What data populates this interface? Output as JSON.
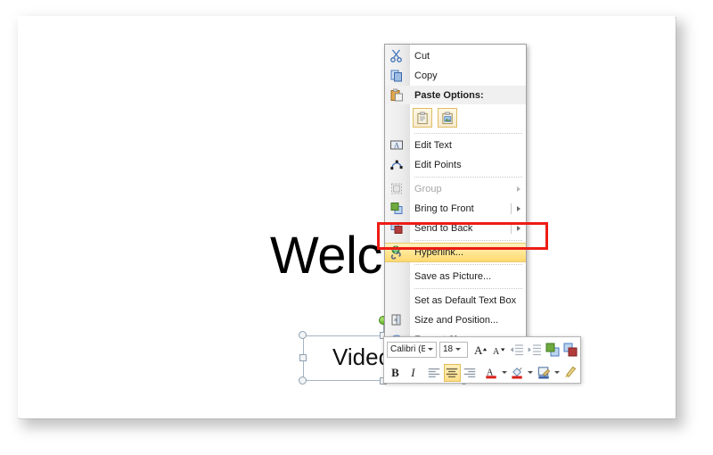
{
  "slide": {
    "title": "Welcome",
    "textbox": {
      "text": "Video 1",
      "name": "video-1-textbox"
    }
  },
  "context_menu": {
    "items": [
      {
        "id": "cut",
        "label": "Cut",
        "accel": "t",
        "icon": "scissors-icon",
        "state": "normal",
        "submenu": false
      },
      {
        "id": "copy",
        "label": "Copy",
        "accel": "C",
        "icon": "copy-pages-icon",
        "state": "normal",
        "submenu": false
      },
      {
        "id": "paste-options",
        "label": "Paste Options:",
        "accel": "",
        "icon": "clipboard-paste-icon",
        "state": "header",
        "submenu": false
      },
      {
        "id": "edit-text",
        "label": "Edit Text",
        "accel": "x",
        "icon": "edit-text-icon",
        "state": "normal",
        "submenu": false
      },
      {
        "id": "edit-points",
        "label": "Edit Points",
        "accel": "E",
        "icon": "edit-points-icon",
        "state": "normal",
        "submenu": false
      },
      {
        "id": "group",
        "label": "Group",
        "accel": "G",
        "icon": "group-icon",
        "state": "disabled",
        "submenu": true
      },
      {
        "id": "bring-to-front",
        "label": "Bring to Front",
        "accel": "r",
        "icon": "bring-front-icon",
        "state": "normal",
        "submenu": true
      },
      {
        "id": "send-to-back",
        "label": "Send to Back",
        "accel": "k",
        "icon": "send-back-icon",
        "state": "normal",
        "submenu": true
      },
      {
        "id": "hyperlink",
        "label": "Hyperlink...",
        "accel": "H",
        "icon": "hyperlink-globe-icon",
        "state": "highlighted",
        "submenu": false
      },
      {
        "id": "save-as-picture",
        "label": "Save as Picture...",
        "accel": "S",
        "icon": "none",
        "state": "normal",
        "submenu": false
      },
      {
        "id": "set-default-textbox",
        "label": "Set as Default Text Box",
        "accel": "D",
        "icon": "none",
        "state": "normal",
        "submenu": false
      },
      {
        "id": "size-position",
        "label": "Size and Position...",
        "accel": "z",
        "icon": "size-position-icon",
        "state": "normal",
        "submenu": false
      },
      {
        "id": "format-shape",
        "label": "Format Shape...",
        "accel": "o",
        "icon": "format-shape-icon",
        "state": "normal",
        "submenu": false
      }
    ],
    "paste_buttons": [
      {
        "id": "paste-keep-source",
        "name": "paste-keep-source-formatting-button"
      },
      {
        "id": "paste-picture",
        "name": "paste-as-picture-button"
      }
    ]
  },
  "annotation": {
    "highlight_color": "#ee1c15",
    "target": "hyperlink"
  },
  "mini_toolbar": {
    "font_name": "Calibri (B",
    "font_size": "18",
    "buttons_row1": [
      {
        "id": "grow-font",
        "label": "A",
        "name": "grow-font-button"
      },
      {
        "id": "shrink-font",
        "label": "A",
        "name": "shrink-font-button"
      },
      {
        "id": "decrease-indent",
        "label": "",
        "name": "decrease-indent-button"
      },
      {
        "id": "increase-indent",
        "label": "",
        "name": "increase-indent-button"
      },
      {
        "id": "bring-forward",
        "label": "",
        "name": "bring-forward-button"
      },
      {
        "id": "send-backward",
        "label": "",
        "name": "send-backward-button"
      }
    ],
    "buttons_row2": [
      {
        "id": "bold",
        "label": "B",
        "name": "bold-button",
        "active": false
      },
      {
        "id": "italic",
        "label": "I",
        "name": "italic-button",
        "active": false
      },
      {
        "id": "align-left",
        "label": "",
        "name": "align-left-button",
        "active": false
      },
      {
        "id": "align-center",
        "label": "",
        "name": "align-center-button",
        "active": true
      },
      {
        "id": "align-right",
        "label": "",
        "name": "align-right-button",
        "active": false
      },
      {
        "id": "font-color",
        "label": "A",
        "name": "font-color-button",
        "active": false
      },
      {
        "id": "fill-color",
        "label": "",
        "name": "shape-fill-button",
        "active": false
      },
      {
        "id": "shape-outline",
        "label": "",
        "name": "shape-outline-button",
        "active": false
      },
      {
        "id": "format-painter",
        "label": "",
        "name": "format-painter-button",
        "active": false
      }
    ]
  }
}
